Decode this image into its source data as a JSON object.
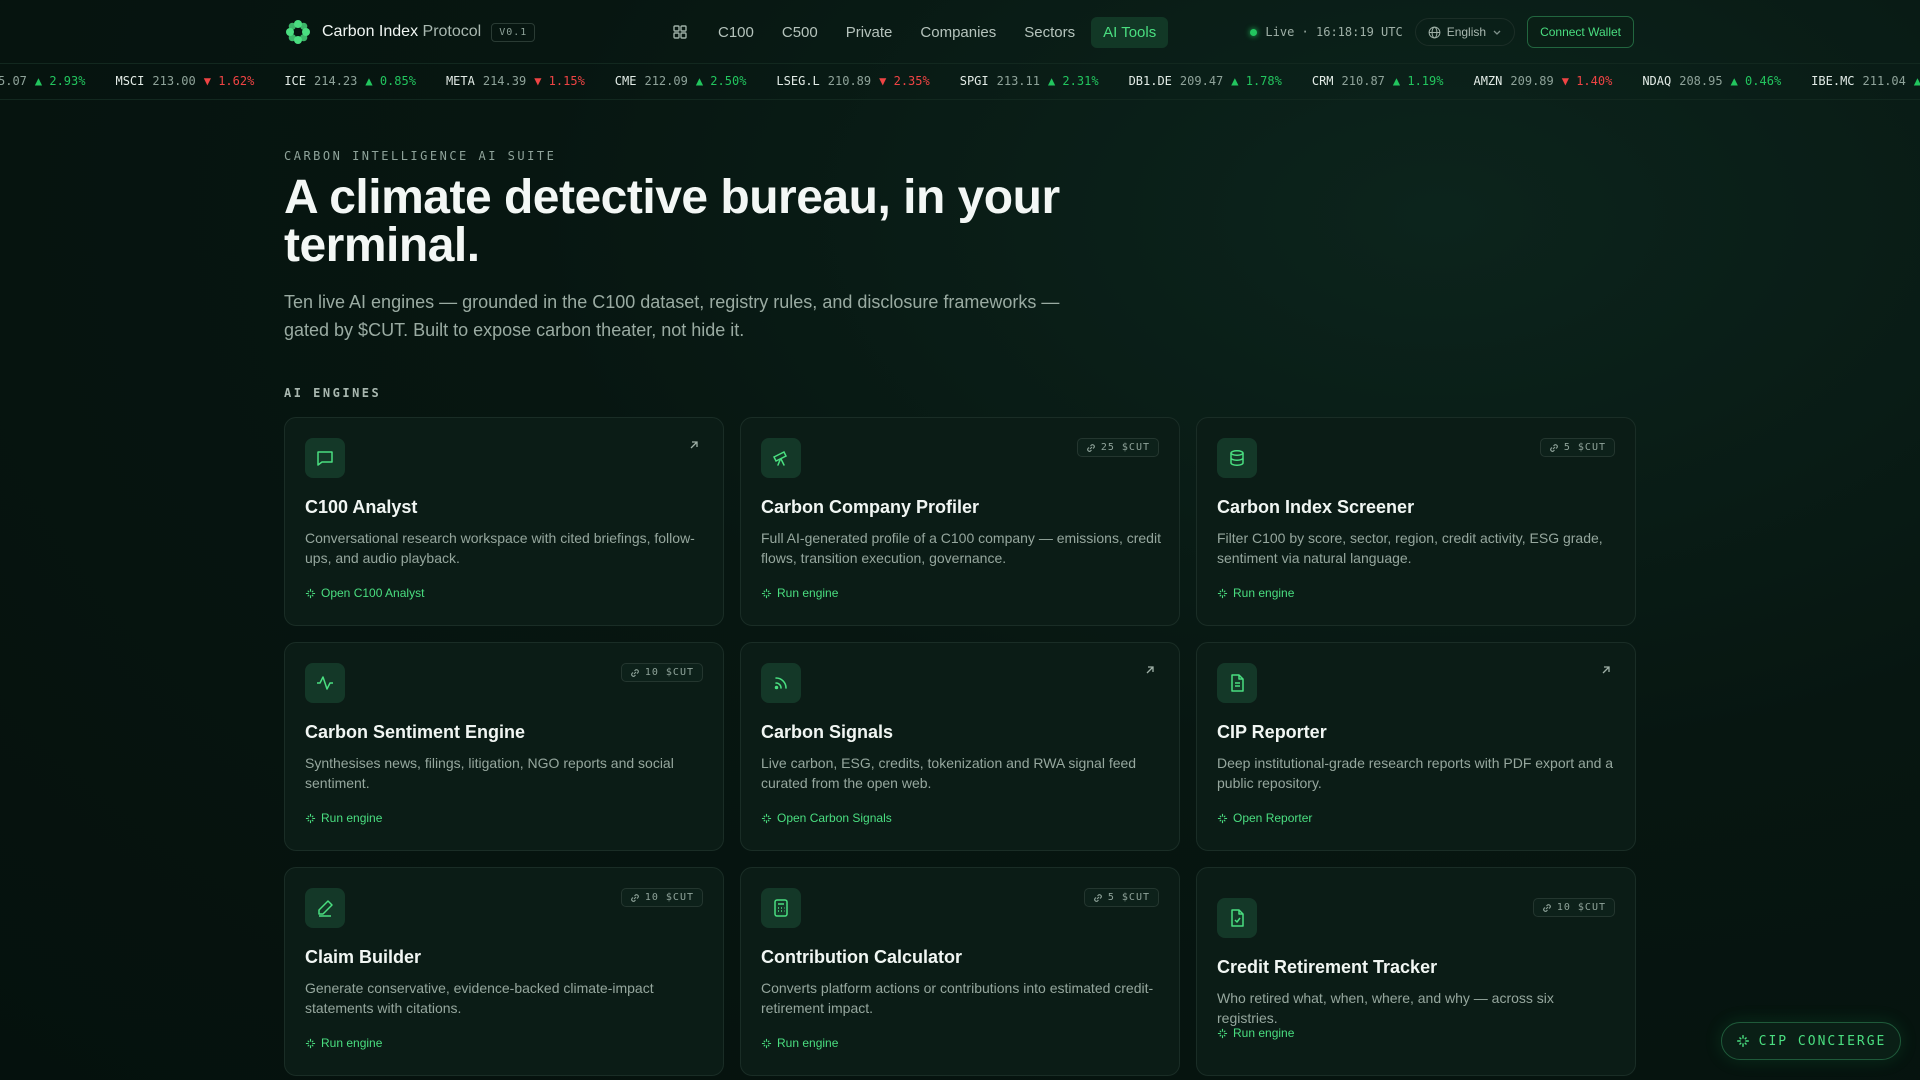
{
  "header": {
    "brand_bold": "Carbon Index",
    "brand_light": "Protocol",
    "version": "V0.1",
    "nav": [
      "C100",
      "C500",
      "Private",
      "Companies",
      "Sectors",
      "AI Tools"
    ],
    "active_nav": "AI Tools",
    "live_label": "Live · 16:18:19 UTC",
    "language": "English",
    "connect_label": "Connect Wallet"
  },
  "ticker": [
    {
      "sym": "",
      "px": "5.07",
      "chg": "▲ 2.93%",
      "dir": "up"
    },
    {
      "sym": "MSCI",
      "px": "213.00",
      "chg": "▼ 1.62%",
      "dir": "down"
    },
    {
      "sym": "ICE",
      "px": "214.23",
      "chg": "▲ 0.85%",
      "dir": "up"
    },
    {
      "sym": "META",
      "px": "214.39",
      "chg": "▼ 1.15%",
      "dir": "down"
    },
    {
      "sym": "CME",
      "px": "212.09",
      "chg": "▲ 2.50%",
      "dir": "up"
    },
    {
      "sym": "LSEG.L",
      "px": "210.89",
      "chg": "▼ 2.35%",
      "dir": "down"
    },
    {
      "sym": "SPGI",
      "px": "213.11",
      "chg": "▲ 2.31%",
      "dir": "up"
    },
    {
      "sym": "DB1.DE",
      "px": "209.47",
      "chg": "▲ 1.78%",
      "dir": "up"
    },
    {
      "sym": "CRM",
      "px": "210.87",
      "chg": "▲ 1.19%",
      "dir": "up"
    },
    {
      "sym": "AMZN",
      "px": "209.89",
      "chg": "▼ 1.40%",
      "dir": "down"
    },
    {
      "sym": "NDAQ",
      "px": "208.95",
      "chg": "▲ 0.46%",
      "dir": "up"
    },
    {
      "sym": "IBE.MC",
      "px": "211.04",
      "chg": "▲",
      "dir": "up"
    }
  ],
  "hero": {
    "eyebrow": "CARBON INTELLIGENCE AI SUITE",
    "title": "A climate detective bureau, in your terminal.",
    "subtitle": "Ten live AI engines — grounded in the C100 dataset, registry rules, and disclosure frameworks — gated by $CUT. Built to expose carbon theater, not hide it."
  },
  "section_label": "AI ENGINES",
  "cards": [
    {
      "title": "C100 Analyst",
      "desc": "Conversational research workspace with cited briefings, follow-ups, and audio playback.",
      "link": "Open C100 Analyst",
      "cost": "",
      "icon": "chat-icon"
    },
    {
      "title": "Carbon Company Profiler",
      "desc": "Full AI-generated profile of a C100 company — emissions, credit flows, transition execution, governance.",
      "link": "Run engine",
      "cost": "25 $CUT",
      "icon": "telescope-icon"
    },
    {
      "title": "Carbon Index Screener",
      "desc": "Filter C100 by score, sector, region, credit activity, ESG grade, sentiment via natural language.",
      "link": "Run engine",
      "cost": "5 $CUT",
      "icon": "database-icon"
    },
    {
      "title": "Carbon Sentiment Engine",
      "desc": "Synthesises news, filings, litigation, NGO reports and social sentiment.",
      "link": "Run engine",
      "cost": "10 $CUT",
      "icon": "activity-icon"
    },
    {
      "title": "Carbon Signals",
      "desc": "Live carbon, ESG, credits, tokenization and RWA signal feed curated from the open web.",
      "link": "Open Carbon Signals",
      "cost": "",
      "icon": "rss-icon"
    },
    {
      "title": "CIP Reporter",
      "desc": "Deep institutional-grade research reports with PDF export and a public repository.",
      "link": "Open Reporter",
      "cost": "",
      "icon": "document-icon"
    },
    {
      "title": "Claim Builder",
      "desc": "Generate conservative, evidence-backed climate-impact statements with citations.",
      "link": "Run engine",
      "cost": "10 $CUT",
      "icon": "pen-icon"
    },
    {
      "title": "Contribution Calculator",
      "desc": "Converts platform actions or contributions into estimated credit-retirement impact.",
      "link": "Run engine",
      "cost": "5 $CUT",
      "icon": "calculator-icon"
    },
    {
      "title": "Credit Retirement Tracker",
      "desc": "Who retired what, when, where, and why — across six registries.",
      "link": "Run engine",
      "cost": "10 $CUT",
      "icon": "file-check-icon"
    }
  ],
  "concierge_label": "CIP CONCIERGE",
  "colors": {
    "accent": "#4ade80",
    "up": "#22c55e",
    "down": "#ef4444",
    "background": "#071611"
  }
}
